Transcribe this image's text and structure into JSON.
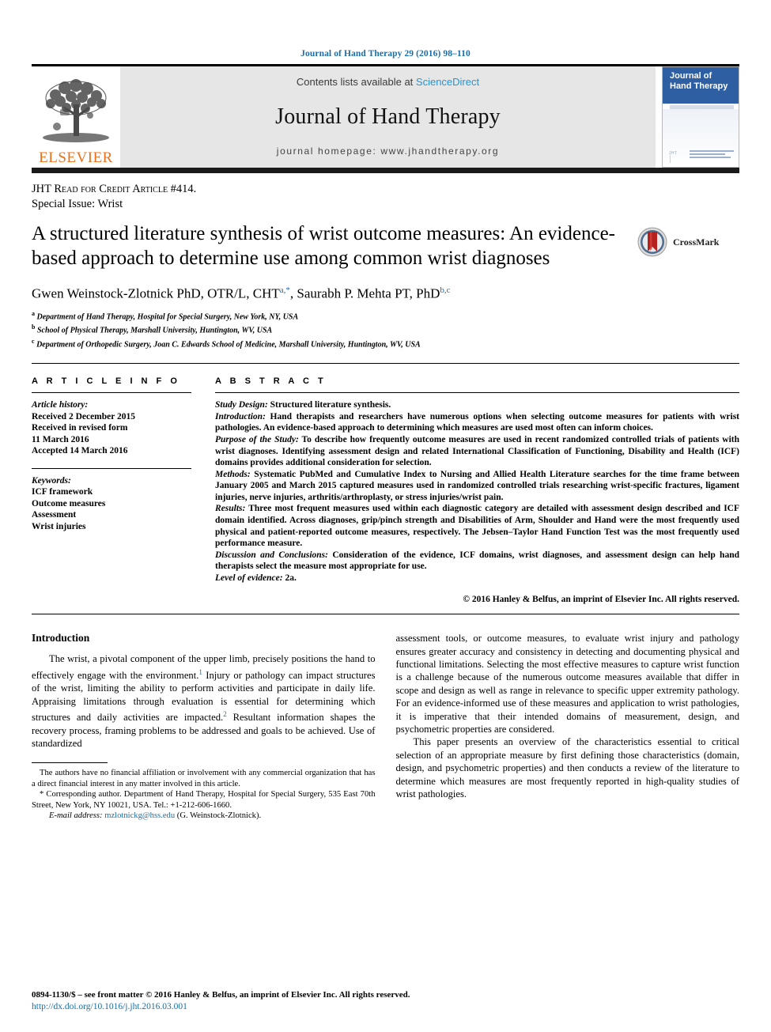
{
  "running_head": "Journal of Hand Therapy 29 (2016) 98–110",
  "masthead": {
    "publisher": "ELSEVIER",
    "contents_prefix": "Contents lists available at ",
    "contents_link": "ScienceDirect",
    "journal_name": "Journal of Hand Therapy",
    "homepage": "journal homepage: www.jhandtherapy.org",
    "cover_title_line1": "Journal of",
    "cover_title_line2": "Hand Therapy",
    "cover_foot_label": "JHT"
  },
  "banner": {
    "credit_line": "JHT Read for Credit Article #414.",
    "special_issue": "Special Issue: Wrist"
  },
  "article": {
    "title": "A structured literature synthesis of wrist outcome measures: An evidence-based approach to determine use among common wrist diagnoses",
    "crossmark_label": "CrossMark",
    "authors_html": "Gwen Weinstock-Zlotnick PhD, OTR/L, CHT<sup>a,*</sup>, Saurabh P. Mehta PT, PhD<sup>b,c</sup>",
    "affiliations": [
      {
        "marker": "a",
        "text": "Department of Hand Therapy, Hospital for Special Surgery, New York, NY, USA"
      },
      {
        "marker": "b",
        "text": "School of Physical Therapy, Marshall University, Huntington, WV, USA"
      },
      {
        "marker": "c",
        "text": "Department of Orthopedic Surgery, Joan C. Edwards School of Medicine, Marshall University, Huntington, WV, USA"
      }
    ]
  },
  "article_info": {
    "heading": "A R T I C L E  I N F O",
    "history_label": "Article history:",
    "history": [
      "Received 2 December 2015",
      "Received in revised form",
      "11 March 2016",
      "Accepted 14 March 2016"
    ],
    "keywords_label": "Keywords:",
    "keywords": [
      "ICF framework",
      "Outcome measures",
      "Assessment",
      "Wrist injuries"
    ]
  },
  "abstract": {
    "heading": "A B S T R A C T",
    "sections": [
      {
        "label": "Study Design:",
        "text": " Structured literature synthesis."
      },
      {
        "label": "Introduction:",
        "text": " Hand therapists and researchers have numerous options when selecting outcome measures for patients with wrist pathologies. An evidence-based approach to determining which measures are used most often can inform choices."
      },
      {
        "label": "Purpose of the Study:",
        "text": " To describe how frequently outcome measures are used in recent randomized controlled trials of patients with wrist diagnoses. Identifying assessment design and related International Classification of Functioning, Disability and Health (ICF) domains provides additional consideration for selection."
      },
      {
        "label": "Methods:",
        "text": " Systematic PubMed and Cumulative Index to Nursing and Allied Health Literature searches for the time frame between January 2005 and March 2015 captured measures used in randomized controlled trials researching wrist-specific fractures, ligament injuries, nerve injuries, arthritis/arthroplasty, or stress injuries/wrist pain."
      },
      {
        "label": "Results:",
        "text": " Three most frequent measures used within each diagnostic category are detailed with assessment design described and ICF domain identified. Across diagnoses, grip/pinch strength and Disabilities of Arm, Shoulder and Hand were the most frequently used physical and patient-reported outcome measures, respectively. The Jebsen–Taylor Hand Function Test was the most frequently used performance measure."
      },
      {
        "label": "Discussion and Conclusions:",
        "text": " Consideration of the evidence, ICF domains, wrist diagnoses, and assessment design can help hand therapists select the measure most appropriate for use."
      },
      {
        "label": "Level of evidence:",
        "text": " 2a."
      }
    ],
    "copyright": "© 2016 Hanley & Belfus, an imprint of Elsevier Inc. All rights reserved."
  },
  "body": {
    "intro_heading": "Introduction",
    "left_paragraph_html": "The wrist, a pivotal component of the upper limb, precisely positions the hand to effectively engage with the environment.<sup>1</sup> Injury or pathology can impact structures of the wrist, limiting the ability to perform activities and participate in daily life. Appraising limitations through evaluation is essential for determining which structures and daily activities are impacted.<sup>2</sup> Resultant information shapes the recovery process, framing problems to be addressed and goals to be achieved. Use of standardized",
    "right_paragraph_1": "assessment tools, or outcome measures, to evaluate wrist injury and pathology ensures greater accuracy and consistency in detecting and documenting physical and functional limitations. Selecting the most effective measures to capture wrist function is a challenge because of the numerous outcome measures available that differ in scope and design as well as range in relevance to specific upper extremity pathology. For an evidence-informed use of these measures and application to wrist pathologies, it is imperative that their intended domains of measurement, design, and psychometric properties are considered.",
    "right_paragraph_2": "This paper presents an overview of the characteristics essential to critical selection of an appropriate measure by first defining those characteristics (domain, design, and psychometric properties) and then conducts a review of the literature to determine which measures are most frequently reported in high-quality studies of wrist pathologies."
  },
  "footnotes": {
    "disclosure": "The authors have no financial affiliation or involvement with any commercial organization that has a direct financial interest in any matter involved in this article.",
    "corresponding": "* Corresponding author. Department of Hand Therapy, Hospital for Special Surgery, 535 East 70th Street, New York, NY 10021, USA. Tel.: +1-212-606-1660.",
    "email_label": "E-mail address:",
    "email": "mzlotnickg@hss.edu",
    "email_suffix": " (G. Weinstock-Zlotnick)."
  },
  "page_footer": {
    "issn_line": "0894-1130/$ – see front matter © 2016 Hanley & Belfus, an imprint of Elsevier Inc. All rights reserved.",
    "doi": "http://dx.doi.org/10.1016/j.jht.2016.03.001"
  },
  "colors": {
    "link_blue": "#1a6ea8",
    "sciencedirect_blue": "#2196d4",
    "elsevier_orange": "#E9711C",
    "cover_blue": "#2e5fa3",
    "masthead_gray": "#e6e6e6"
  }
}
